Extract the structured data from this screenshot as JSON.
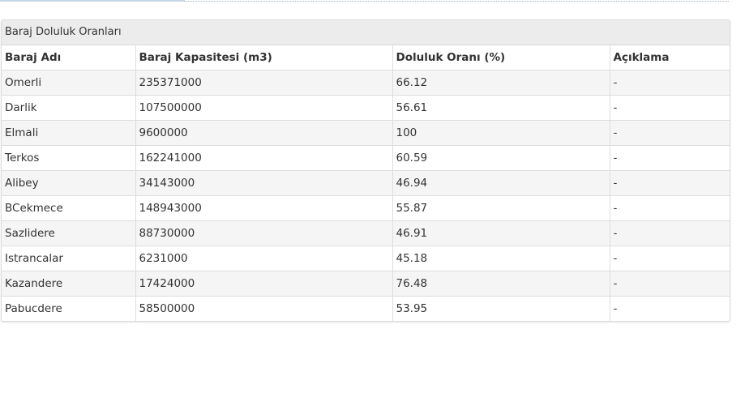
{
  "panel": {
    "title": "Baraj Doluluk Oranları"
  },
  "table": {
    "headers": [
      "Baraj Adı",
      "Baraj Kapasitesi (m3)",
      "Doluluk Oranı (%)",
      "Açıklama"
    ],
    "rows": [
      [
        "Omerli",
        "235371000",
        "66.12",
        "-"
      ],
      [
        "Darlik",
        "107500000",
        "56.61",
        "-"
      ],
      [
        "Elmali",
        "9600000",
        "100",
        "-"
      ],
      [
        "Terkos",
        "162241000",
        "60.59",
        "-"
      ],
      [
        "Alibey",
        "34143000",
        "46.94",
        "-"
      ],
      [
        "BCekmece",
        "148943000",
        "55.87",
        "-"
      ],
      [
        "Sazlidere",
        "88730000",
        "46.91",
        "-"
      ],
      [
        "Istrancalar",
        "6231000",
        "45.18",
        "-"
      ],
      [
        "Kazandere",
        "17424000",
        "76.48",
        "-"
      ],
      [
        "Pabucdere",
        "58500000",
        "53.95",
        "-"
      ]
    ]
  }
}
